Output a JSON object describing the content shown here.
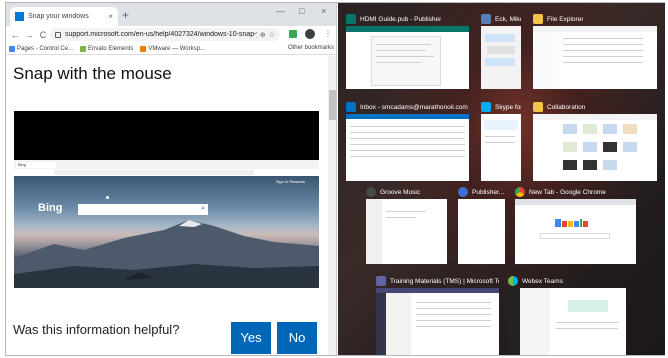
{
  "chrome": {
    "tab_title": "Snap your windows",
    "tab_close": "×",
    "new_tab": "+",
    "minimize": "—",
    "maximize": "□",
    "close": "×",
    "back": "←",
    "forward": "→",
    "reload": "C",
    "url": "support.microsoft.com/en-us/help/4027324/windows-10-snap-your...",
    "bookmarks": [
      "Pages - Control Ce...",
      "Envato Elements",
      "VMware — Worksp..."
    ],
    "other_bookmarks": "Other bookmarks",
    "bookmark_colors": [
      "#4285f4",
      "#7cb342",
      "#f57c00"
    ]
  },
  "page": {
    "title": "Snap with the mouse",
    "feedback_question": "Was this information helpful?",
    "yes_label": "Yes",
    "no_label": "No",
    "accent": "#0067b8"
  },
  "video": {
    "inner_tab": "Bing",
    "bing_logo": "Bing",
    "bing_top": "Sign in  Rewards"
  },
  "taskview": {
    "windows": [
      {
        "label": "HDMI Guide.pub - Publisher",
        "color": "#077568"
      },
      {
        "label": "Eck, Mike...",
        "color": "#5a7fb8"
      },
      {
        "label": "File Explorer",
        "color": "#f4c542"
      },
      {
        "label": "Inbox - smcadams@marathonoil.com - ...",
        "color": "#0072c6"
      },
      {
        "label": "Skype for...",
        "color": "#00aff0"
      },
      {
        "label": "Collaboration",
        "color": "#f4c542"
      },
      {
        "label": "Groove Music",
        "color": "#4a4a4a"
      },
      {
        "label": "Publisher...",
        "color": "#3b6fd6"
      },
      {
        "label": "New Tab - Google Chrome",
        "color": "#e8e8e8"
      },
      {
        "label": "Training Materials (TMS) | Microsoft Teams",
        "color": "#6264a7"
      },
      {
        "label": "Webex Teams",
        "color": "#e8e8e8"
      }
    ]
  }
}
